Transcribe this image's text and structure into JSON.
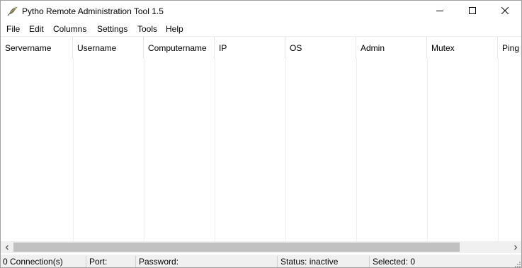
{
  "window": {
    "title": "Pytho Remote Administration Tool 1.5"
  },
  "menu": [
    "File",
    "Edit",
    "Columns",
    "Settings",
    "Tools",
    "Help"
  ],
  "columns": [
    "Servername",
    "Username",
    "Computername",
    "IP",
    "OS",
    "Admin",
    "Mutex",
    "Ping"
  ],
  "statusbar": {
    "connections": "0 Connection(s)",
    "port": "Port:",
    "password": "Password:",
    "status": "Status: inactive",
    "selected": "Selected: 0"
  },
  "icons": {
    "app": "feather-icon",
    "minimize": "minimize-icon",
    "maximize": "maximize-icon",
    "close": "close-icon",
    "scroll_left": "chevron-left-icon",
    "scroll_right": "chevron-right-icon",
    "resize_grip": "resize-grip-icon"
  }
}
